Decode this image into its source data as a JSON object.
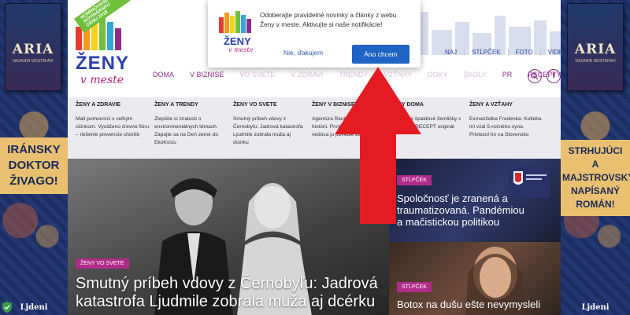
{
  "left_ad": {
    "book_title": "ARIA",
    "book_sub": "NAZANIN MOSTAFAVI",
    "slogan_lines": [
      "IRÁNSKY",
      "DOKTOR",
      "ŽIVAGO!"
    ],
    "brand": "Ljdeni"
  },
  "right_ad": {
    "book_title": "ARIA",
    "book_sub": "NAZANIN MOSTAFAVI",
    "slogan_lines": [
      "STRHUJÚCI",
      "A MAJSTROVSKY",
      "NAPÍSANÝ",
      "ROMÁN!"
    ],
    "brand": "Ljdeni"
  },
  "logo": {
    "name": "ŽENY",
    "script": "v meste",
    "ribbon": "NOMINOVANÉ NA NOVINÁRSKU CENU 2018"
  },
  "top_nav": [
    "NAJ",
    "STĹPČEK",
    "FOTO",
    "VIDEÁ"
  ],
  "main_nav": [
    "DOMA",
    "V BIZNISE",
    "VO SVETE",
    "V ZDRAVÍ",
    "TRENDY",
    "VZŤAHY",
    "DOKY",
    "ŠKOLY",
    "PR",
    "RECEPTY"
  ],
  "icons": {
    "search": "search-icon",
    "facebook": "facebook-icon"
  },
  "mega_menu": [
    {
      "heading": "ŽENY A ZDRAVIE",
      "text": "Malí pomocníci s veľkým účinkom. Vyváženú črevnú flóru – riešenie prevencie chorôb"
    },
    {
      "heading": "ŽENY A TRENDY",
      "text": "Zlepšite si znalosti o environmentálnych témach. Zapojte sa na Deň zeme do EkoKvízu"
    },
    {
      "heading": "ŽENY VO SVETE",
      "text": "Smutný príbeh vdovy z Černobyľu: Jadrová katastrofa Ljudmile zobrala muža aj dcérku"
    },
    {
      "heading": "ŽENY V BIZNISE",
      "text": "Agentúra Reuters po prvýkrát v histórii. Prvýkrát na čele a vedúca ju povedie žena"
    },
    {
      "heading": "ŽENY DOMA",
      "text": "Zapekajte špaldové žemličky s bylinkami, RECEPT originál"
    },
    {
      "heading": "ŽENY A VZŤAHY",
      "text": "Exmanželka Fredenka: Kotleba mi vzal 5-ročného syna. Priviezol ho na Slovensko"
    }
  ],
  "feature": {
    "tag": "ŽENY VO SVETE",
    "title": "Smutný príbeh vdovy z Černobyľu: Jadrová katastrofa Ljudmile zobrala muža aj dcérku"
  },
  "card1": {
    "tag": "STĹPČEK",
    "title": "Spoločnosť je zranená a traumatizovaná. Pandémiou a mačistickou politikou"
  },
  "card2": {
    "tag": "STĹPČEK",
    "title": "Botox na dušu ešte nevymysleli"
  },
  "popup": {
    "text": "Odoberajte pravidelné novinky a články z webu Ženy v meste. Aktivujte si naše notifikácie!",
    "logo_name": "ŽENY",
    "logo_script": "v meste",
    "no_label": "Nie, ďakujem",
    "yes_label": "Áno chcem"
  },
  "colors": {
    "accent": "#8c2d8c",
    "tag": "#b02b8a",
    "button": "#1f63c4",
    "arrow": "#e51b24"
  }
}
